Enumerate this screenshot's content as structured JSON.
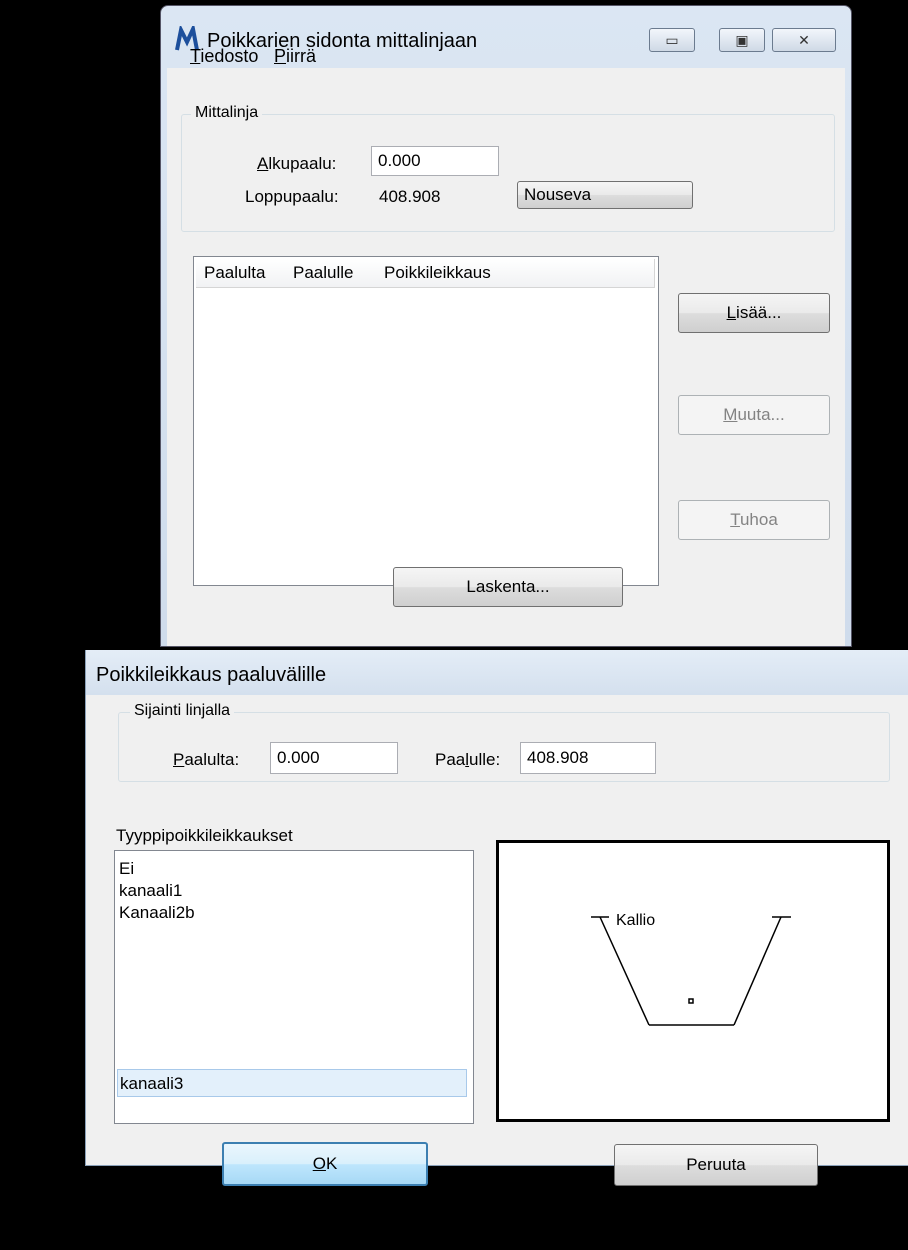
{
  "main_window": {
    "title": "Poikkarien sidonta mittalinjaan",
    "menu": [
      {
        "accel": "T",
        "rest": "iedosto"
      },
      {
        "accel": "P",
        "rest": "iirrä"
      }
    ],
    "group_title": "Mittalinja",
    "start_label_accel": "A",
    "start_label_rest": "lkupaalu:",
    "start_value": "0.000",
    "end_label": "Loppupaalu:",
    "end_value": "408.908",
    "direction_button": "Nouseva",
    "columns": [
      "Paalulta",
      "Paalulle",
      "Poikkileikkaus"
    ],
    "add_accel": "L",
    "add_rest": "isää...",
    "modify_accel": "M",
    "modify_rest": "uuta...",
    "delete_accel": "T",
    "delete_rest": "uhoa",
    "calculate_button": "Laskenta..."
  },
  "dialog": {
    "title": "Poikkileikkaus paaluvälille",
    "group_title": "Sijainti linjalla",
    "from_accel": "P",
    "from_rest": "aalulta:",
    "from_value": "0.000",
    "to_pre": "Paa",
    "to_accel": "l",
    "to_rest": "ulle:",
    "to_value": "408.908",
    "list_label": "Tyyppipoikkileikkaukset",
    "types": [
      "Ei",
      "kanaali1",
      "Kanaali2b"
    ],
    "selected_type": "kanaali3",
    "preview_label": "Kallio",
    "ok_accel": "O",
    "ok_rest": "K",
    "cancel_button": "Peruuta"
  },
  "icons": {
    "app": "microstation-m-icon",
    "minimize": "minimize-icon",
    "maximize": "maximize-icon",
    "close": "close-icon"
  },
  "colors": {
    "title_bar": "#d4e0ee",
    "window_bg": "#f0f0f0",
    "desktop": "#000000"
  }
}
